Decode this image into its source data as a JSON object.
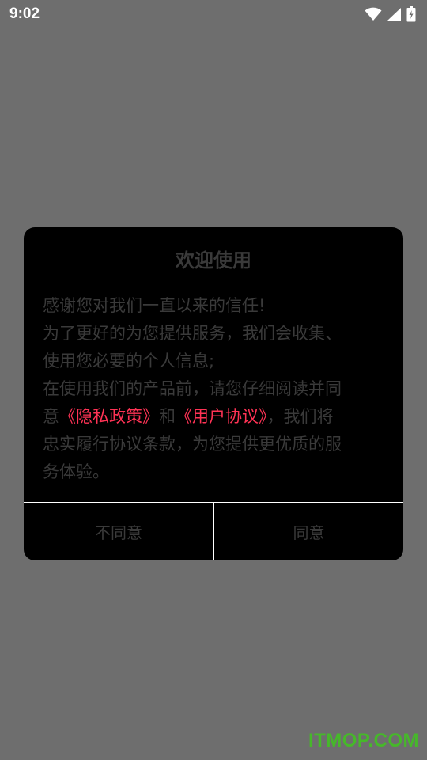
{
  "status_bar": {
    "time": "9:02",
    "icons": [
      "wifi-icon",
      "cell-signal-icon",
      "battery-charging-icon"
    ]
  },
  "dialog": {
    "title": "欢迎使用",
    "body": {
      "line1": "感谢您对我们一直以来的信任!",
      "line2": "为了更好的为您提供服务，我们会收集、",
      "line3": "使用您必要的个人信息;",
      "line4": "在使用我们的产品前，请您仔细阅读并同",
      "line5_pre": "意",
      "privacy_link": "《隐私政策》",
      "line5_mid": "和",
      "agreement_link": "《用户协议》",
      "line5_post": "，我们将",
      "line6": "忠实履行协议条款，为您提供更优质的服",
      "line7": "务体验。"
    },
    "decline_label": "不同意",
    "accept_label": "同意"
  },
  "watermark": "ITMOP.COM",
  "colors": {
    "overlay": "#6e6e6e",
    "dialog_bg": "#000000",
    "dialog_text": "#3a3a3a",
    "link": "#ff3355",
    "watermark": "#46b82a"
  }
}
